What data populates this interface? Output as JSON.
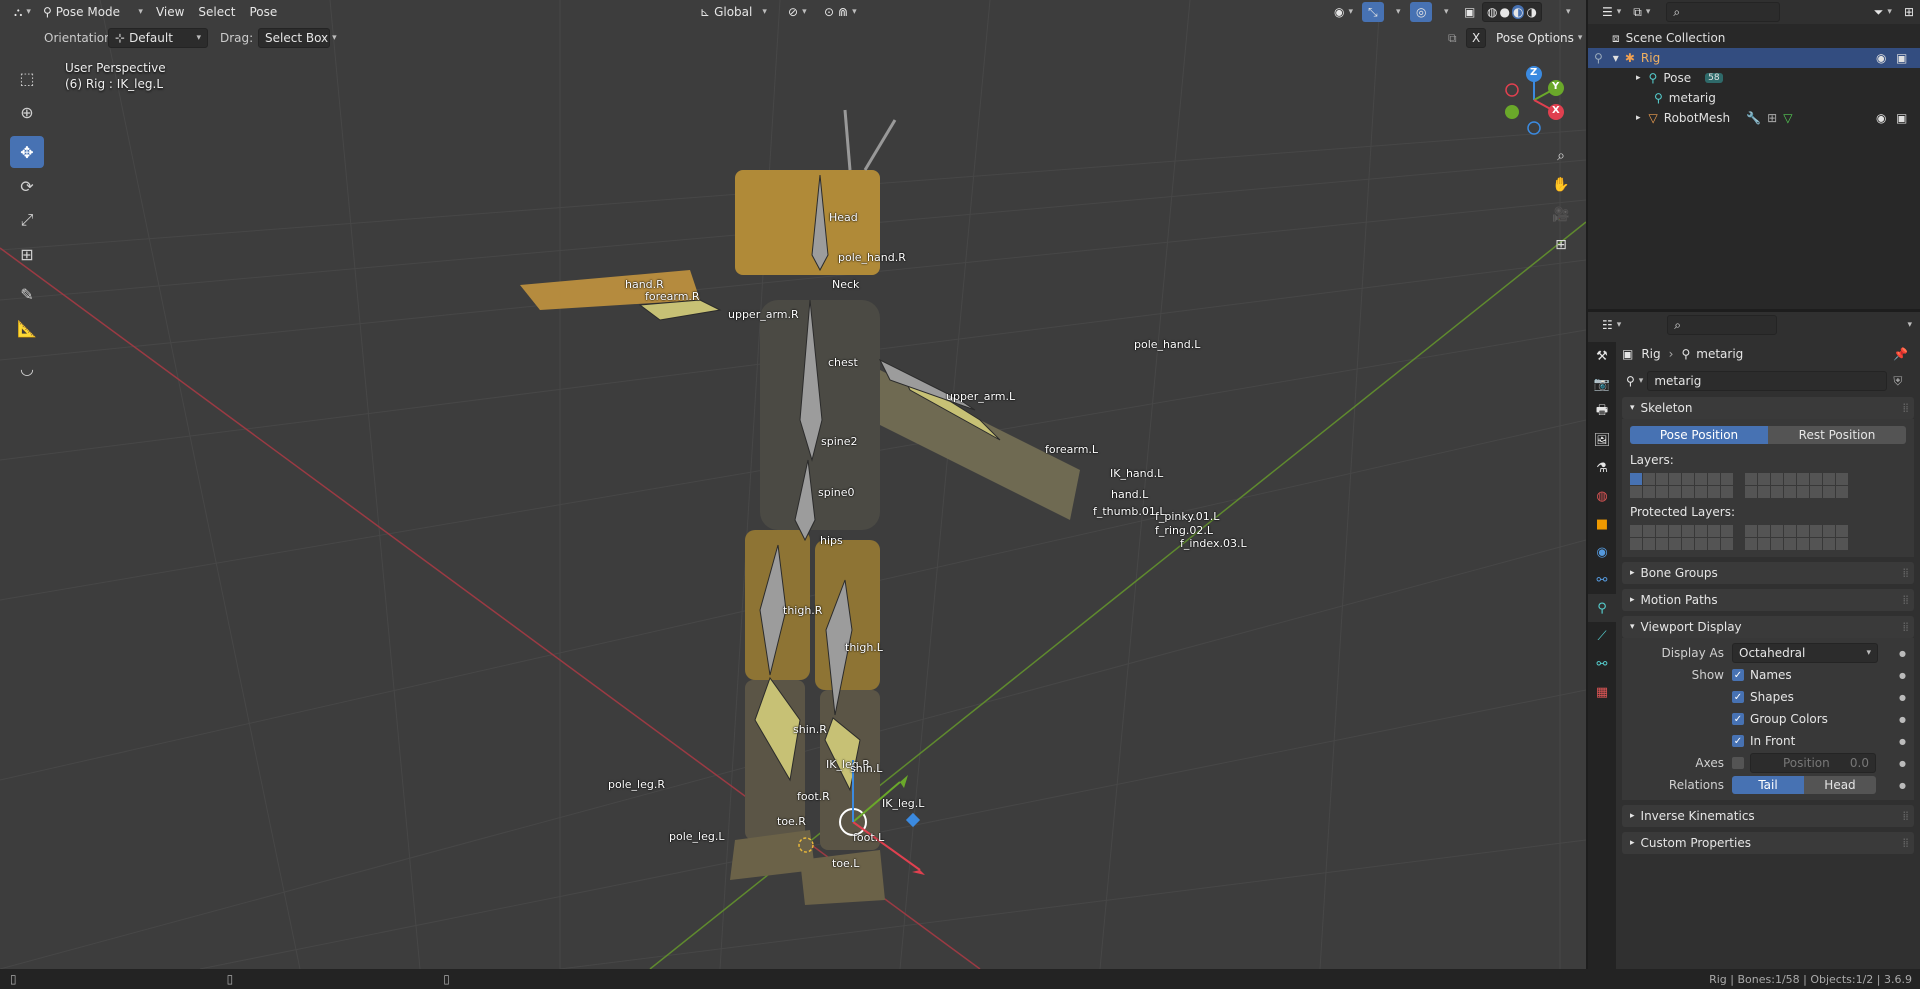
{
  "header": {
    "mode": "Pose Mode",
    "menus": [
      "View",
      "Select",
      "Pose"
    ],
    "transform_orientation": "Global",
    "orientation_label": "Orientation:",
    "orientation_value": "Default",
    "drag_label": "Drag:",
    "drag_value": "Select Box",
    "pose_options": "Pose Options",
    "x_mirror": "X"
  },
  "viewport": {
    "perspective": "User Perspective",
    "active": "(6) Rig : IK_leg.L",
    "axes": {
      "z": "Z",
      "y": "Y",
      "x": "X"
    },
    "bones": [
      {
        "name": "Head",
        "label": "Head"
      },
      {
        "name": "pole_hand.R",
        "label": "pole_hand.R"
      },
      {
        "name": "Neck",
        "label": "Neck"
      },
      {
        "name": "hand.R",
        "label": "hand.R"
      },
      {
        "name": "forearm.R",
        "label": "forearm.R"
      },
      {
        "name": "upper_arm.R",
        "label": "upper_arm.R"
      },
      {
        "name": "pole_hand.L",
        "label": "pole_hand.L"
      },
      {
        "name": "chest",
        "label": "chest"
      },
      {
        "name": "upper_arm.L",
        "label": "upper_arm.L"
      },
      {
        "name": "spine2",
        "label": "spine2"
      },
      {
        "name": "forearm.L",
        "label": "forearm.L"
      },
      {
        "name": "IK_hand.L",
        "label": "IK_hand.L"
      },
      {
        "name": "spine0",
        "label": "spine0"
      },
      {
        "name": "hand.L",
        "label": "hand.L"
      },
      {
        "name": "hips",
        "label": "hips"
      },
      {
        "name": "thigh.R",
        "label": "thigh.R"
      },
      {
        "name": "thigh.L",
        "label": "thigh.L"
      },
      {
        "name": "shin.R",
        "label": "shin.R"
      },
      {
        "name": "IK_leg.R",
        "label": "IK_leg.R"
      },
      {
        "name": "shin.L",
        "label": "shin.L"
      },
      {
        "name": "pole_leg.R",
        "label": "pole_leg.R"
      },
      {
        "name": "foot.R",
        "label": "foot.R"
      },
      {
        "name": "IK_leg.L",
        "label": "IK_leg.L"
      },
      {
        "name": "toe.R",
        "label": "toe.R"
      },
      {
        "name": "pole_leg.L",
        "label": "pole_leg.L"
      },
      {
        "name": "foot.L",
        "label": "foot.L"
      },
      {
        "name": "toe.L",
        "label": "toe.L"
      },
      {
        "name": "f_thumb.01.L",
        "label": "f_thumb.01.L"
      },
      {
        "name": "f_pinky.01.L",
        "label": "f_pinky.01.L"
      },
      {
        "name": "f_ring.02.L",
        "label": "f_ring.02.L"
      },
      {
        "name": "f_index.03.L",
        "label": "f_index.03.L"
      }
    ]
  },
  "outliner": {
    "title": "Scene Collection",
    "items": [
      {
        "name": "Rig"
      },
      {
        "name": "Pose",
        "badge": "58"
      },
      {
        "name": "metarig"
      },
      {
        "name": "RobotMesh"
      }
    ]
  },
  "properties": {
    "breadcrumb": [
      "Rig",
      "metarig"
    ],
    "datablock": "metarig",
    "skeleton": {
      "title": "Skeleton",
      "pose_position": "Pose Position",
      "rest_position": "Rest Position",
      "layers_label": "Layers:",
      "protected_label": "Protected Layers:"
    },
    "panels": {
      "bone_groups": "Bone Groups",
      "motion_paths": "Motion Paths",
      "viewport_display": "Viewport Display",
      "inverse_kinematics": "Inverse Kinematics",
      "custom_properties": "Custom Properties"
    },
    "display": {
      "display_as_label": "Display As",
      "display_as_value": "Octahedral",
      "show_label": "Show",
      "names": "Names",
      "shapes": "Shapes",
      "group_colors": "Group Colors",
      "in_front": "In Front",
      "axes_label": "Axes",
      "position_label": "Position",
      "position_value": "0.0",
      "relations_label": "Relations",
      "tail": "Tail",
      "head": "Head"
    }
  },
  "status": "Rig | Bones:1/58 | Objects:1/2 | 3.6.9",
  "colors": {
    "accent": "#4772b3",
    "x_axis": "#e0404f",
    "y_axis": "#6aa82a",
    "z_axis": "#3b8ae0",
    "bone": "#8c8c8c"
  }
}
